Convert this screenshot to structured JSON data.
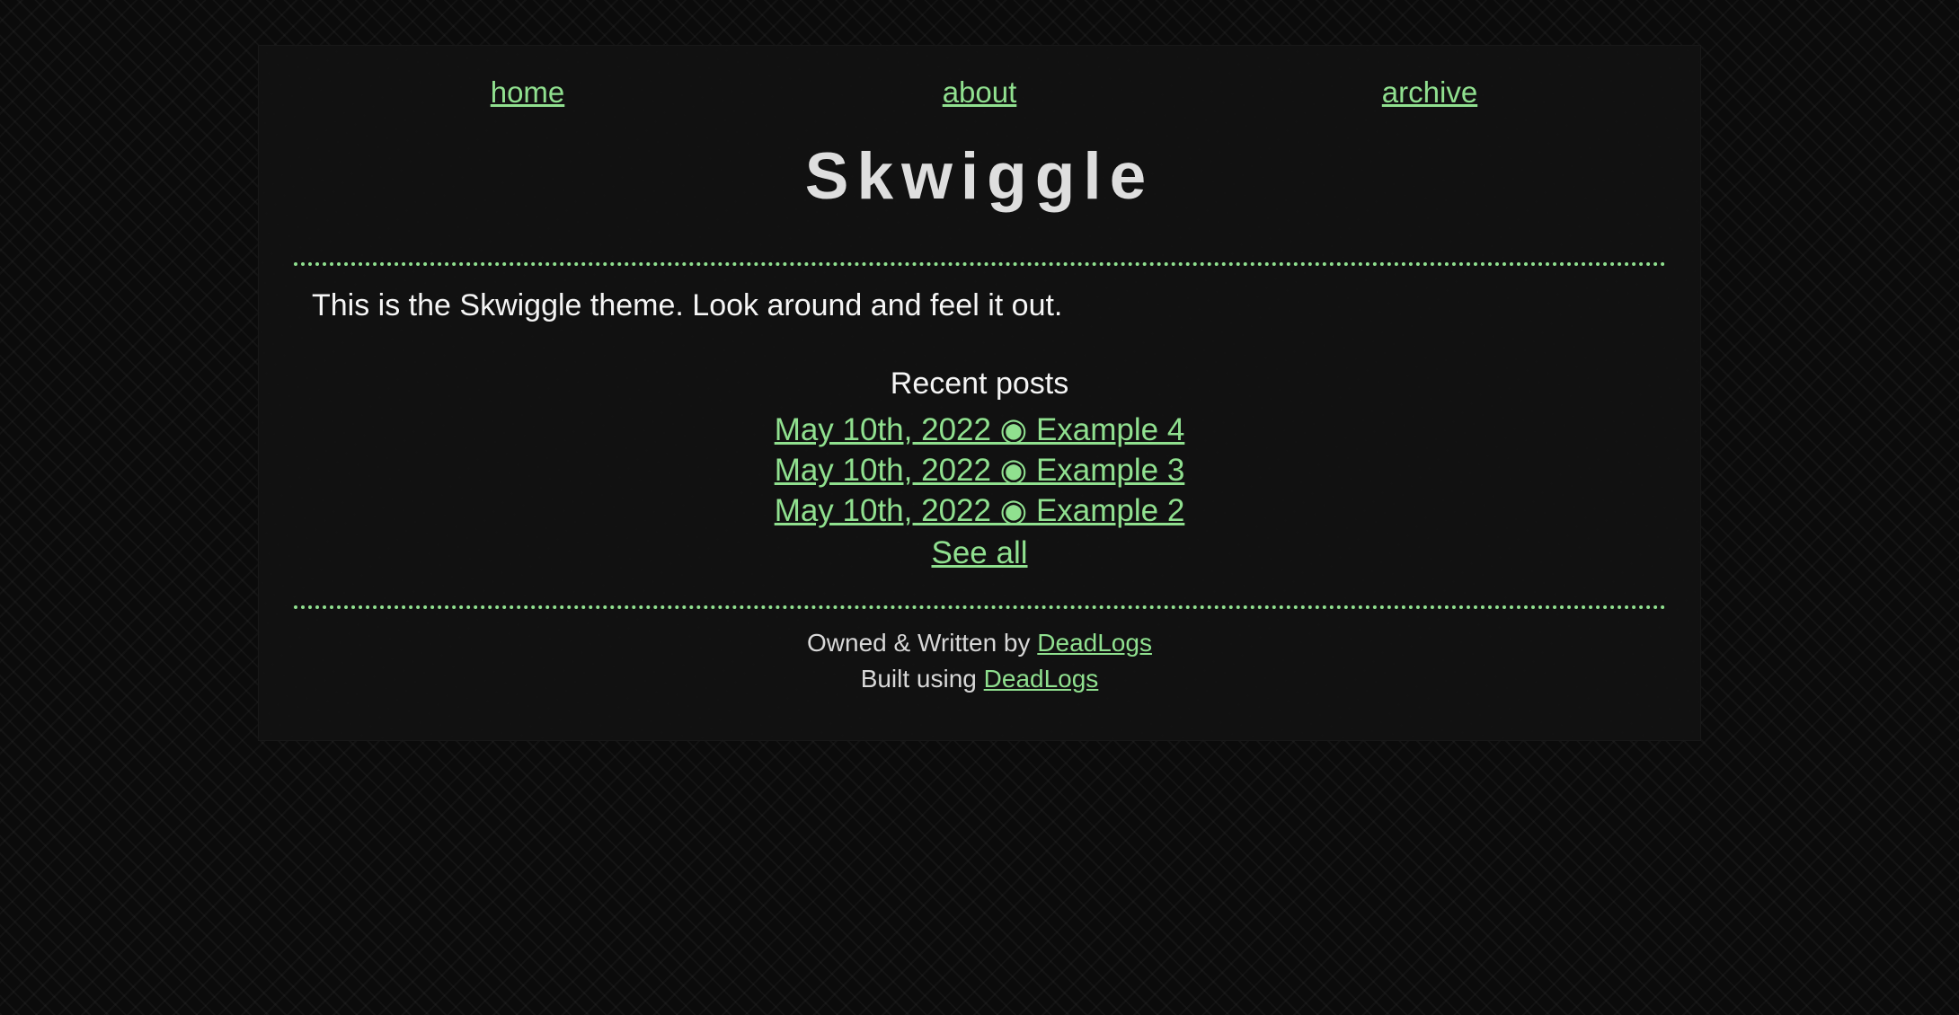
{
  "nav": {
    "items": [
      {
        "label": "home"
      },
      {
        "label": "about"
      },
      {
        "label": "archive"
      }
    ]
  },
  "site": {
    "title": "Skwiggle",
    "intro": "This is the Skwiggle theme. Look around and feel it out."
  },
  "recent_posts": {
    "heading": "Recent posts",
    "items": [
      {
        "label": "May 10th, 2022 ◉ Example 4"
      },
      {
        "label": "May 10th, 2022 ◉ Example 3"
      },
      {
        "label": "May 10th, 2022 ◉ Example 2"
      }
    ],
    "see_all": "See all"
  },
  "footer": {
    "owned_prefix": "Owned & Written by",
    "owned_link": "DeadLogs",
    "built_prefix": "Built using",
    "built_link": "DeadLogs"
  },
  "colors": {
    "accent": "#90e08f",
    "text": "#f2f2f2",
    "panel": "#121212",
    "background": "#0b0b0b"
  }
}
